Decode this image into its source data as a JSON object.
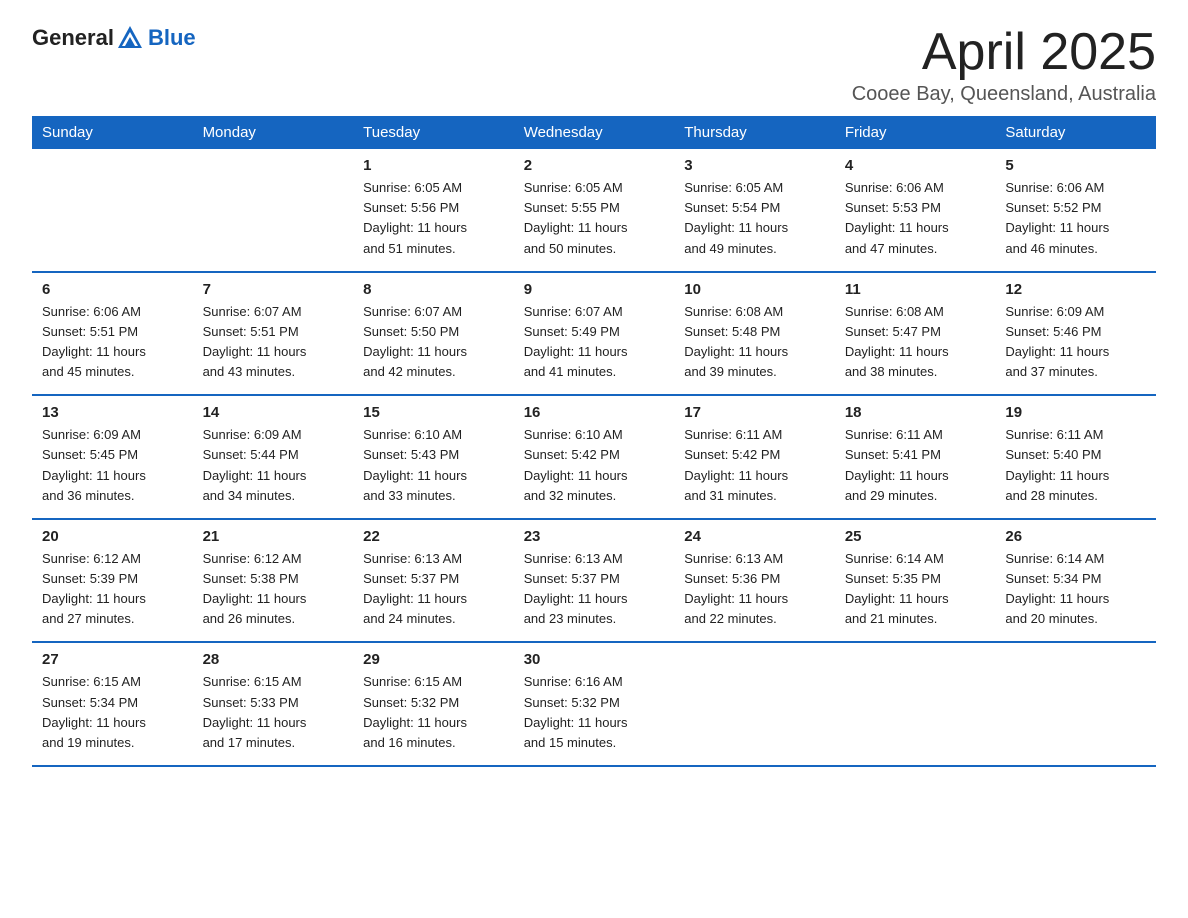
{
  "logo": {
    "text_general": "General",
    "text_blue": "Blue"
  },
  "title": "April 2025",
  "subtitle": "Cooee Bay, Queensland, Australia",
  "header_days": [
    "Sunday",
    "Monday",
    "Tuesday",
    "Wednesday",
    "Thursday",
    "Friday",
    "Saturday"
  ],
  "weeks": [
    [
      {
        "day": "",
        "info": ""
      },
      {
        "day": "",
        "info": ""
      },
      {
        "day": "1",
        "info": "Sunrise: 6:05 AM\nSunset: 5:56 PM\nDaylight: 11 hours\nand 51 minutes."
      },
      {
        "day": "2",
        "info": "Sunrise: 6:05 AM\nSunset: 5:55 PM\nDaylight: 11 hours\nand 50 minutes."
      },
      {
        "day": "3",
        "info": "Sunrise: 6:05 AM\nSunset: 5:54 PM\nDaylight: 11 hours\nand 49 minutes."
      },
      {
        "day": "4",
        "info": "Sunrise: 6:06 AM\nSunset: 5:53 PM\nDaylight: 11 hours\nand 47 minutes."
      },
      {
        "day": "5",
        "info": "Sunrise: 6:06 AM\nSunset: 5:52 PM\nDaylight: 11 hours\nand 46 minutes."
      }
    ],
    [
      {
        "day": "6",
        "info": "Sunrise: 6:06 AM\nSunset: 5:51 PM\nDaylight: 11 hours\nand 45 minutes."
      },
      {
        "day": "7",
        "info": "Sunrise: 6:07 AM\nSunset: 5:51 PM\nDaylight: 11 hours\nand 43 minutes."
      },
      {
        "day": "8",
        "info": "Sunrise: 6:07 AM\nSunset: 5:50 PM\nDaylight: 11 hours\nand 42 minutes."
      },
      {
        "day": "9",
        "info": "Sunrise: 6:07 AM\nSunset: 5:49 PM\nDaylight: 11 hours\nand 41 minutes."
      },
      {
        "day": "10",
        "info": "Sunrise: 6:08 AM\nSunset: 5:48 PM\nDaylight: 11 hours\nand 39 minutes."
      },
      {
        "day": "11",
        "info": "Sunrise: 6:08 AM\nSunset: 5:47 PM\nDaylight: 11 hours\nand 38 minutes."
      },
      {
        "day": "12",
        "info": "Sunrise: 6:09 AM\nSunset: 5:46 PM\nDaylight: 11 hours\nand 37 minutes."
      }
    ],
    [
      {
        "day": "13",
        "info": "Sunrise: 6:09 AM\nSunset: 5:45 PM\nDaylight: 11 hours\nand 36 minutes."
      },
      {
        "day": "14",
        "info": "Sunrise: 6:09 AM\nSunset: 5:44 PM\nDaylight: 11 hours\nand 34 minutes."
      },
      {
        "day": "15",
        "info": "Sunrise: 6:10 AM\nSunset: 5:43 PM\nDaylight: 11 hours\nand 33 minutes."
      },
      {
        "day": "16",
        "info": "Sunrise: 6:10 AM\nSunset: 5:42 PM\nDaylight: 11 hours\nand 32 minutes."
      },
      {
        "day": "17",
        "info": "Sunrise: 6:11 AM\nSunset: 5:42 PM\nDaylight: 11 hours\nand 31 minutes."
      },
      {
        "day": "18",
        "info": "Sunrise: 6:11 AM\nSunset: 5:41 PM\nDaylight: 11 hours\nand 29 minutes."
      },
      {
        "day": "19",
        "info": "Sunrise: 6:11 AM\nSunset: 5:40 PM\nDaylight: 11 hours\nand 28 minutes."
      }
    ],
    [
      {
        "day": "20",
        "info": "Sunrise: 6:12 AM\nSunset: 5:39 PM\nDaylight: 11 hours\nand 27 minutes."
      },
      {
        "day": "21",
        "info": "Sunrise: 6:12 AM\nSunset: 5:38 PM\nDaylight: 11 hours\nand 26 minutes."
      },
      {
        "day": "22",
        "info": "Sunrise: 6:13 AM\nSunset: 5:37 PM\nDaylight: 11 hours\nand 24 minutes."
      },
      {
        "day": "23",
        "info": "Sunrise: 6:13 AM\nSunset: 5:37 PM\nDaylight: 11 hours\nand 23 minutes."
      },
      {
        "day": "24",
        "info": "Sunrise: 6:13 AM\nSunset: 5:36 PM\nDaylight: 11 hours\nand 22 minutes."
      },
      {
        "day": "25",
        "info": "Sunrise: 6:14 AM\nSunset: 5:35 PM\nDaylight: 11 hours\nand 21 minutes."
      },
      {
        "day": "26",
        "info": "Sunrise: 6:14 AM\nSunset: 5:34 PM\nDaylight: 11 hours\nand 20 minutes."
      }
    ],
    [
      {
        "day": "27",
        "info": "Sunrise: 6:15 AM\nSunset: 5:34 PM\nDaylight: 11 hours\nand 19 minutes."
      },
      {
        "day": "28",
        "info": "Sunrise: 6:15 AM\nSunset: 5:33 PM\nDaylight: 11 hours\nand 17 minutes."
      },
      {
        "day": "29",
        "info": "Sunrise: 6:15 AM\nSunset: 5:32 PM\nDaylight: 11 hours\nand 16 minutes."
      },
      {
        "day": "30",
        "info": "Sunrise: 6:16 AM\nSunset: 5:32 PM\nDaylight: 11 hours\nand 15 minutes."
      },
      {
        "day": "",
        "info": ""
      },
      {
        "day": "",
        "info": ""
      },
      {
        "day": "",
        "info": ""
      }
    ]
  ]
}
